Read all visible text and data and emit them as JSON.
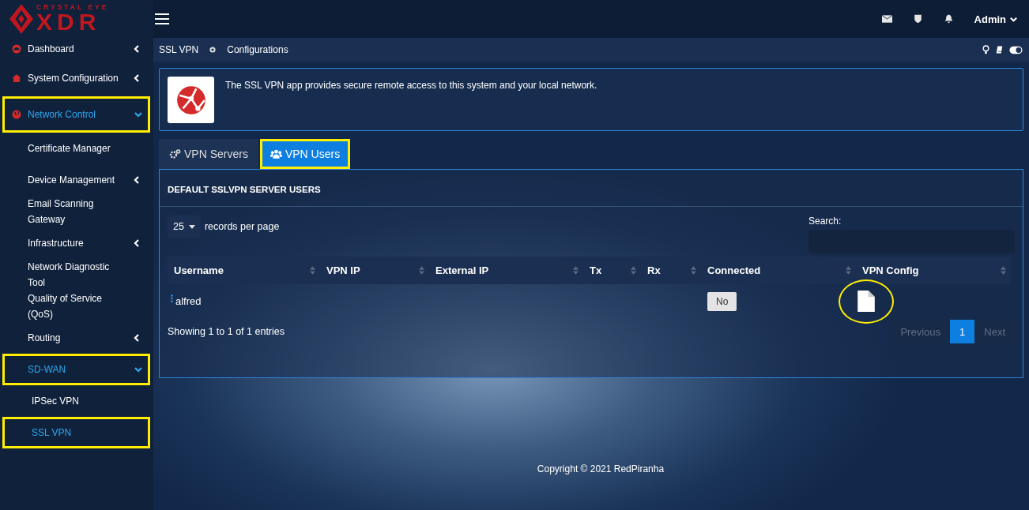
{
  "brand": {
    "top": "CRYSTAL EYE",
    "main": "XDR"
  },
  "topbar": {
    "user": "Admin"
  },
  "sidebar": {
    "items": [
      {
        "label": "Dashboard",
        "kind": "menu",
        "expanded": false,
        "highlighted": false,
        "selected": false
      },
      {
        "label": "System Configuration",
        "kind": "menu",
        "expanded": false,
        "highlighted": false,
        "selected": false
      },
      {
        "label": "Network Control",
        "kind": "menu",
        "expanded": true,
        "highlighted": true,
        "selected": true,
        "children": [
          {
            "label": "Certificate Manager",
            "kind": "leaf",
            "expanded": false,
            "highlighted": false,
            "selected": false
          },
          {
            "label": "Device Management",
            "kind": "menu",
            "expanded": false,
            "highlighted": false,
            "selected": false
          },
          {
            "label": "Email Scanning Gateway",
            "kind": "leaf",
            "expanded": false,
            "highlighted": false,
            "selected": false
          },
          {
            "label": "Infrastructure",
            "kind": "menu",
            "expanded": false,
            "highlighted": false,
            "selected": false
          },
          {
            "label": "Network Diagnostic Tool",
            "kind": "leaf",
            "expanded": false,
            "highlighted": false,
            "selected": false
          },
          {
            "label": "Quality of Service (QoS)",
            "kind": "leaf",
            "expanded": false,
            "highlighted": false,
            "selected": false
          },
          {
            "label": "Routing",
            "kind": "menu",
            "expanded": false,
            "highlighted": false,
            "selected": false
          },
          {
            "label": "SD-WAN",
            "kind": "menu",
            "expanded": true,
            "highlighted": true,
            "selected": true,
            "children": [
              {
                "label": "IPSec VPN",
                "kind": "leaf",
                "expanded": false,
                "highlighted": false,
                "selected": false
              },
              {
                "label": "SSL VPN",
                "kind": "leaf",
                "expanded": false,
                "highlighted": true,
                "selected": true
              }
            ]
          }
        ]
      }
    ]
  },
  "breadcrumb": [
    "SSL VPN",
    "Configurations"
  ],
  "info": {
    "text": "The SSL VPN app provides secure remote access to this system and your local network."
  },
  "tabs": [
    {
      "label": "VPN Servers",
      "selected": false,
      "highlighted": false
    },
    {
      "label": "VPN Users",
      "selected": true,
      "highlighted": true
    }
  ],
  "panel": {
    "title": "DEFAULT SSLVPN SERVER USERS"
  },
  "length": {
    "value": "25",
    "label": "records per page"
  },
  "search": {
    "label": "Search:"
  },
  "table": {
    "columns": [
      "Username",
      "VPN IP",
      "External IP",
      "Tx",
      "Rx",
      "Connected",
      "VPN Config"
    ],
    "rows": [
      {
        "username": "alfred",
        "connected": "No",
        "config_highlighted": true
      }
    ]
  },
  "info_text": "Showing 1 to 1 of 1 entries",
  "pagination": [
    {
      "label": "Previous",
      "selected": false,
      "disabled": true
    },
    {
      "label": "1",
      "selected": true,
      "disabled": false
    },
    {
      "label": "Next",
      "selected": false,
      "disabled": true
    }
  ],
  "footer": "Copyright © 2021 RedPiranha"
}
